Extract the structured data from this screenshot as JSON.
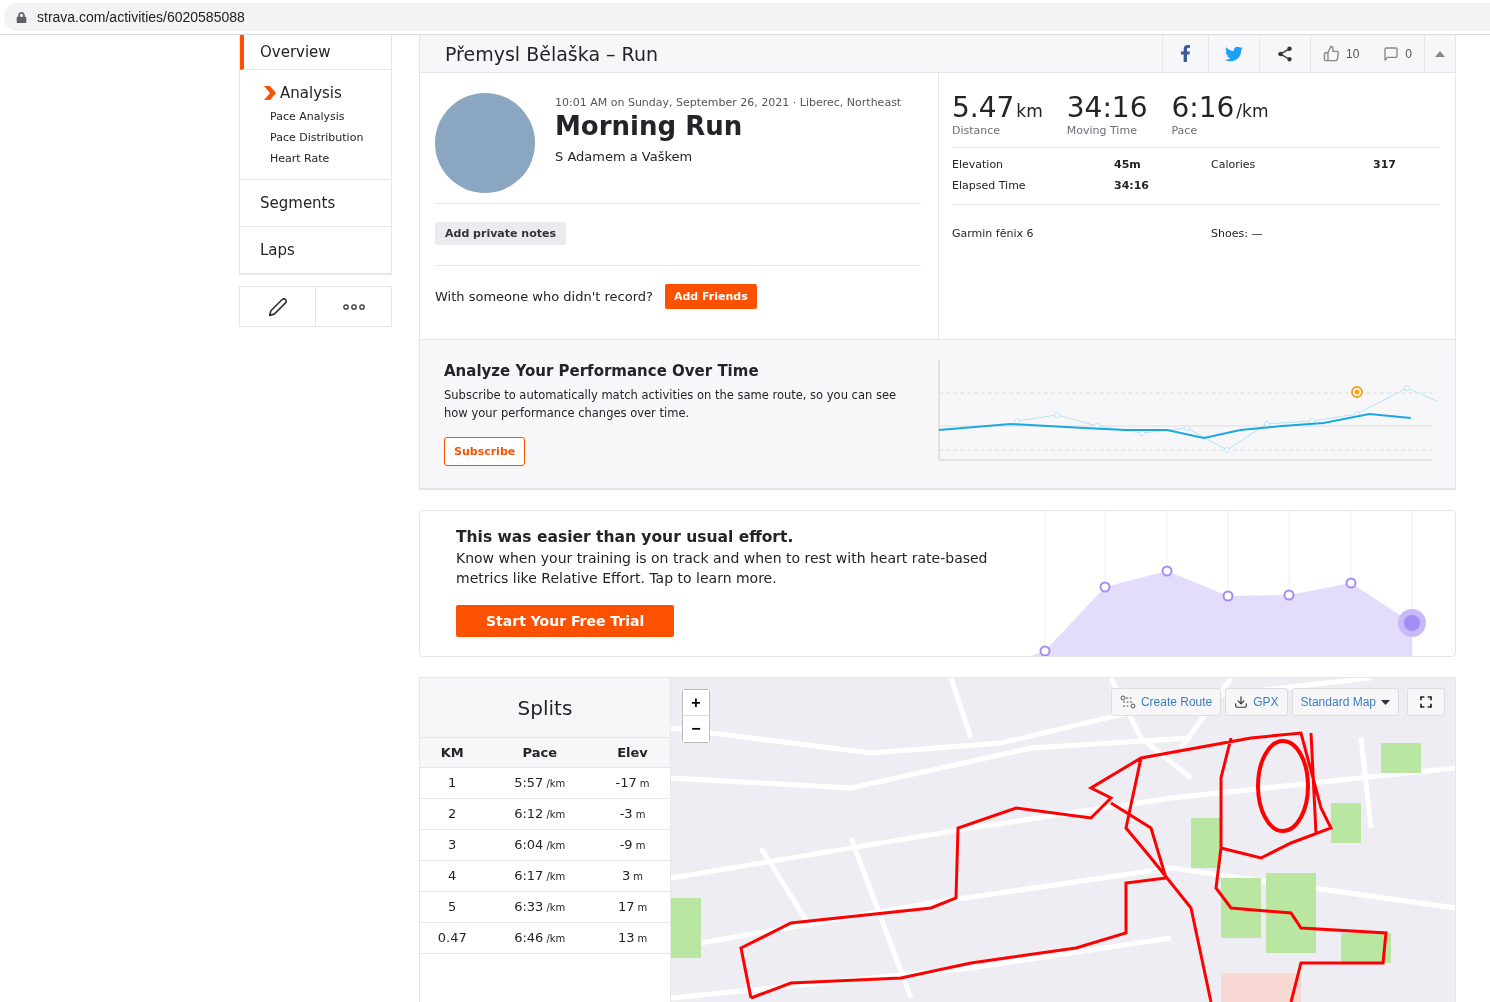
{
  "address_bar": {
    "url": "strava.com/activities/6020585088"
  },
  "sidebar": {
    "items": [
      {
        "label": "Overview",
        "selected": true,
        "expanded": false
      },
      {
        "label": "Analysis",
        "selected": false,
        "expanded": true,
        "children": [
          {
            "label": "Pace Analysis"
          },
          {
            "label": "Pace Distribution"
          },
          {
            "label": "Heart Rate"
          }
        ]
      },
      {
        "label": "Segments",
        "selected": false,
        "expanded": false
      },
      {
        "label": "Laps",
        "selected": false,
        "expanded": false
      }
    ]
  },
  "header": {
    "title": "Přemysl Bělaška – Run",
    "kudos": "10",
    "comments": "0"
  },
  "activity": {
    "meta": "10:01 AM on Sunday, September 26, 2021 · Liberec, Northeast",
    "name": "Morning Run",
    "description": "S Adamem a Vaškem",
    "notes_button": "Add private notes",
    "with_prompt": "With someone who didn't record?",
    "add_friends": "Add Friends"
  },
  "stats": {
    "primary": [
      {
        "value": "5.47",
        "unit": "km",
        "label": "Distance"
      },
      {
        "value": "34:16",
        "label": "Moving Time"
      },
      {
        "value": "6:16",
        "unit": "/km",
        "label": "Pace"
      }
    ],
    "secondary": [
      {
        "label": "Elevation",
        "value": "45m"
      },
      {
        "label": "Calories",
        "value": "317"
      },
      {
        "label": "Elapsed Time",
        "value": "34:16"
      }
    ],
    "device": "Garmin fēnix 6",
    "shoes_label": "Shoes:",
    "shoes_value": "—"
  },
  "performance": {
    "title": "Analyze Your Performance Over Time",
    "text": "Subscribe to automatically match activities on the same route, so you can see how your performance changes over time.",
    "button": "Subscribe"
  },
  "effort": {
    "title": "This was easier than your usual effort.",
    "text": "Know when your training is on track and when to rest with heart rate-based metrics like Relative Effort. Tap to learn more.",
    "button": "Start Your Free Trial"
  },
  "splits": {
    "title": "Splits",
    "columns": [
      "KM",
      "Pace",
      "Elev"
    ],
    "rows": [
      {
        "km": "1",
        "pace": "5:57",
        "pace_unit": "/km",
        "elev": "-17",
        "elev_unit": "m"
      },
      {
        "km": "2",
        "pace": "6:12",
        "pace_unit": "/km",
        "elev": "-3",
        "elev_unit": "m"
      },
      {
        "km": "3",
        "pace": "6:04",
        "pace_unit": "/km",
        "elev": "-9",
        "elev_unit": "m"
      },
      {
        "km": "4",
        "pace": "6:17",
        "pace_unit": "/km",
        "elev": "3",
        "elev_unit": "m"
      },
      {
        "km": "5",
        "pace": "6:33",
        "pace_unit": "/km",
        "elev": "17",
        "elev_unit": "m"
      },
      {
        "km": "0.47",
        "pace": "6:46",
        "pace_unit": "/km",
        "elev": "13",
        "elev_unit": "m"
      }
    ]
  },
  "map": {
    "zoom_in": "+",
    "zoom_out": "−",
    "create_route": "Create Route",
    "gpx": "GPX",
    "map_type": "Standard Map"
  }
}
